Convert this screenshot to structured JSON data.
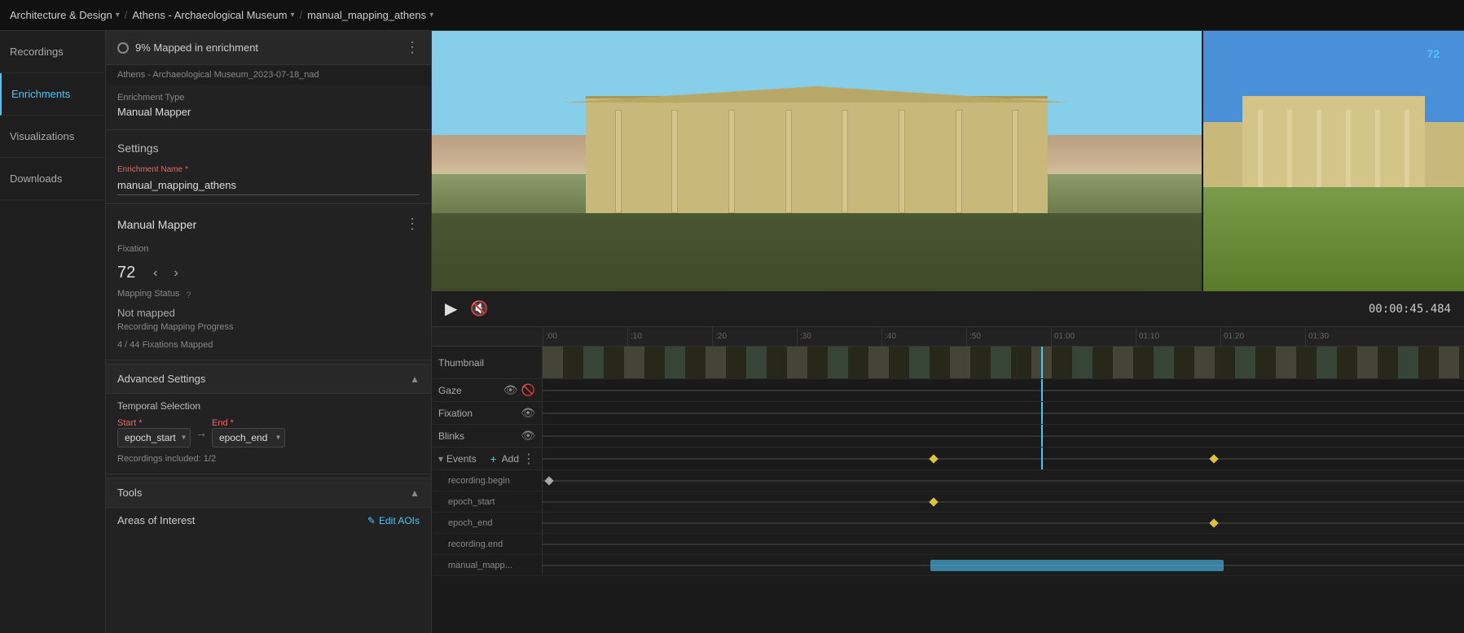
{
  "topbar": {
    "breadcrumb1": "Architecture & Design",
    "breadcrumb2": "Athens - Archaeological Museum",
    "breadcrumb3": "manual_mapping_athens"
  },
  "sidebar": {
    "items": [
      {
        "id": "recordings",
        "label": "Recordings"
      },
      {
        "id": "enrichments",
        "label": "Enrichments"
      },
      {
        "id": "visualizations",
        "label": "Visualizations"
      },
      {
        "id": "downloads",
        "label": "Downloads"
      }
    ]
  },
  "panel": {
    "status_label": "9% Mapped in enrichment",
    "file_label": "Athens - Archaeological Museum_2023-07-18_nad",
    "enrichment_type_label": "Enrichment Type",
    "enrichment_type_value": "Manual Mapper",
    "settings_label": "Settings",
    "enrichment_name_label": "Enrichment Name",
    "enrichment_name_required": "*",
    "enrichment_name_value": "manual_mapping_athens",
    "mapper_label": "Manual Mapper",
    "fixation_label": "Fixation",
    "fixation_value": "72",
    "mapping_status_label": "Mapping Status",
    "mapping_status_value": "Not mapped",
    "recording_progress_label": "Recording Mapping Progress",
    "recording_progress_value": "4 / 44 Fixations Mapped",
    "advanced_settings_label": "Advanced Settings",
    "temporal_selection_label": "Temporal Selection",
    "start_label": "Start",
    "start_required": "*",
    "end_label": "End",
    "end_required": "*",
    "start_value": "epoch_start",
    "end_value": "epoch_end",
    "recordings_included": "Recordings included: 1/2",
    "tools_label": "Tools",
    "aoi_label": "Areas of Interest",
    "edit_aoi_label": "Edit AOIs"
  },
  "controls": {
    "time_display": "00:00:45.484",
    "play_icon": "▶",
    "mute_icon": "🔇"
  },
  "timeline": {
    "ruler_marks": [
      ":00",
      ":10",
      ":20",
      ":30",
      ":40",
      ":50",
      "01:00",
      "01:10",
      "01:20",
      "01:30"
    ],
    "tracks": [
      {
        "id": "thumbnail",
        "label": "Thumbnail"
      },
      {
        "id": "gaze",
        "label": "Gaze"
      },
      {
        "id": "fixation",
        "label": "Fixation"
      },
      {
        "id": "blinks",
        "label": "Blinks"
      },
      {
        "id": "events",
        "label": "Events"
      }
    ],
    "sub_events": [
      {
        "id": "recording_begin",
        "label": "recording.begin"
      },
      {
        "id": "epoch_start",
        "label": "epoch_start"
      },
      {
        "id": "epoch_end",
        "label": "epoch_end"
      },
      {
        "id": "recording_end",
        "label": "recording.end"
      },
      {
        "id": "manual_mapping",
        "label": "manual_mapp..."
      }
    ]
  }
}
